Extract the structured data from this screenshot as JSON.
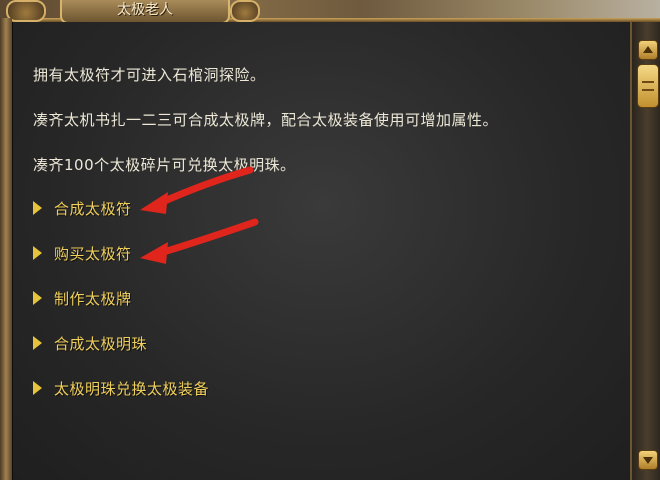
{
  "window": {
    "title": "太极老人"
  },
  "dialog": {
    "paragraphs": [
      "拥有太极符才可进入石棺洞探险。",
      "凑齐太机书扎一二三可合成太极牌，配合太极装备使用可增加属性。",
      "凑齐100个太极碎片可兑换太极明珠。"
    ],
    "options": [
      {
        "label": "合成太极符"
      },
      {
        "label": "购买太极符"
      },
      {
        "label": "制作太极牌"
      },
      {
        "label": "合成太极明珠"
      },
      {
        "label": "太极明珠兑换太极装备"
      }
    ]
  },
  "colors": {
    "option_text": "#f0cf5a",
    "body_text": "#ece7d6",
    "annotation_arrow": "#e0261c"
  }
}
